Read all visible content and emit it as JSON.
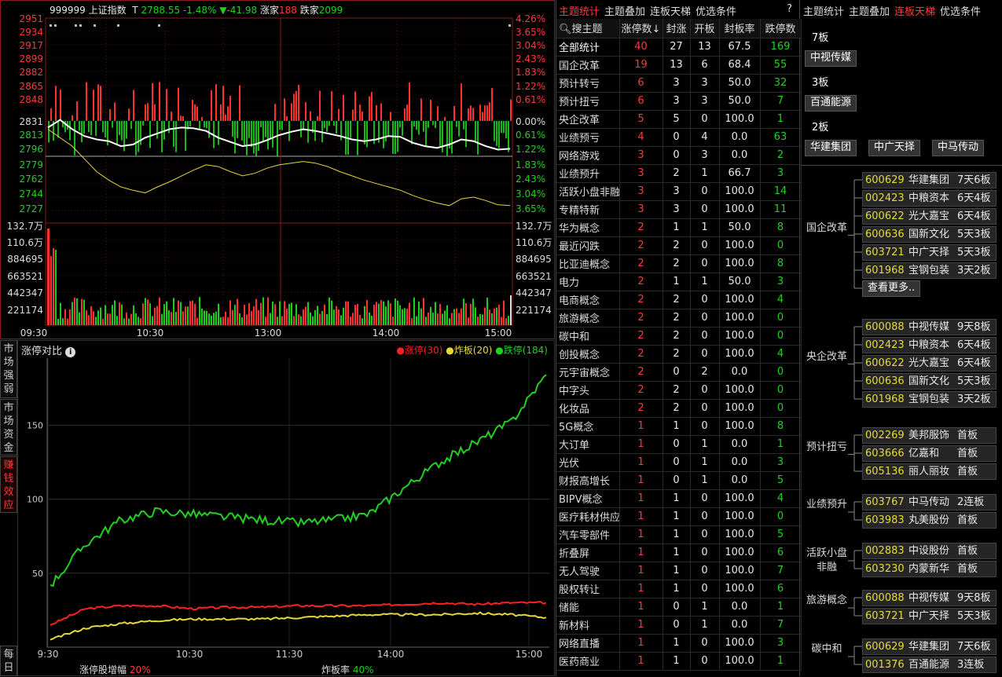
{
  "index_header": {
    "code": "999999",
    "name": "上证指数",
    "t": "T",
    "price": "2788.55",
    "pct": "-1.48%",
    "change": "▼-41.98",
    "up_label": "涨家",
    "up_count": "188",
    "down_label": "跌家",
    "down_count": "2099"
  },
  "price_axis_left": [
    "2951",
    "2934",
    "2917",
    "2899",
    "2882",
    "2865",
    "2848",
    "2831",
    "2813",
    "2796",
    "2779",
    "2762",
    "2744",
    "2727"
  ],
  "price_axis_right": [
    "4.26%",
    "3.65%",
    "3.04%",
    "2.43%",
    "1.83%",
    "1.22%",
    "0.61%",
    "0.00%",
    "0.61%",
    "1.22%",
    "1.83%",
    "2.43%",
    "3.04%",
    "3.65%"
  ],
  "volume_axis_left": [
    "132.7万",
    "110.6万",
    "884695",
    "663521",
    "442347",
    "221174"
  ],
  "volume_axis_right": [
    "132.7万",
    "110.6万",
    "884695",
    "663521",
    "442347",
    "221174"
  ],
  "time_axis": [
    "09:30",
    "10:30",
    "13:00",
    "14:00",
    "15:00"
  ],
  "compare_panel": {
    "title": "涨停对比",
    "info_icon": "info-icon",
    "legend": [
      {
        "label": "涨停(30)",
        "color": "#ff2020"
      },
      {
        "label": "炸板(20)",
        "color": "#e5d93a"
      },
      {
        "label": "跌停(184)",
        "color": "#22d022"
      }
    ],
    "footer_left_label": "涨停股增幅",
    "footer_left_value": "20%",
    "footer_right_label": "炸板率",
    "footer_right_value": "40%"
  },
  "side_tabs": [
    {
      "label": "市场强弱"
    },
    {
      "label": "市场资金"
    },
    {
      "label": "赚钱效应"
    },
    {
      "label": "每日"
    }
  ],
  "chart_data": [
    {
      "type": "line",
      "title": "上证指数",
      "x_range": [
        "09:30",
        "15:00"
      ],
      "ylim": [
        2727,
        2951
      ],
      "series": [
        {
          "name": "上证指数",
          "color": "#ffffff",
          "values": [
            2822,
            2831,
            2820,
            2812,
            2808,
            2806,
            2800,
            2802,
            2810,
            2815,
            2820,
            2822,
            2821,
            2818,
            2810,
            2805,
            2800,
            2802,
            2807,
            2813,
            2817,
            2820,
            2818,
            2815,
            2812,
            2808,
            2806,
            2808,
            2812,
            2811,
            2804,
            2800,
            2798,
            2802,
            2808,
            2806,
            2800,
            2796,
            2797
          ]
        },
        {
          "name": "领先指标",
          "color": "#e5d93a",
          "values": [
            2820,
            2810,
            2800,
            2785,
            2770,
            2760,
            2752,
            2748,
            2745,
            2752,
            2758,
            2765,
            2772,
            2778,
            2776,
            2770,
            2765,
            2768,
            2774,
            2778,
            2780,
            2782,
            2780,
            2776,
            2770,
            2765,
            2760,
            2756,
            2752,
            2748,
            2742,
            2737,
            2733,
            2730,
            2738,
            2740,
            2736,
            2731,
            2730
          ]
        }
      ]
    },
    {
      "type": "line",
      "title": "涨停对比",
      "x": [
        "9:30",
        "10:30",
        "11:30",
        "14:00",
        "15:00"
      ],
      "ylim": [
        0,
        190
      ],
      "yticks": [
        50,
        100,
        150
      ],
      "series": [
        {
          "name": "涨停",
          "color": "#ff2020",
          "values": [
            15,
            26,
            28,
            28,
            26,
            27,
            27,
            28,
            28,
            28,
            29,
            30,
            29,
            30,
            30
          ]
        },
        {
          "name": "炸板",
          "color": "#e5d93a",
          "values": [
            5,
            13,
            16,
            18,
            19,
            19,
            19,
            20,
            21,
            22,
            22,
            22,
            23,
            22,
            20
          ]
        },
        {
          "name": "跌停",
          "color": "#22d022",
          "values": [
            42,
            70,
            86,
            92,
            90,
            88,
            86,
            84,
            86,
            90,
            108,
            125,
            138,
            152,
            184
          ]
        }
      ]
    }
  ],
  "theme_tabs": {
    "tabs": [
      "主题统计",
      "主题叠加",
      "连板天梯",
      "优选条件"
    ],
    "help": "?"
  },
  "theme_table": {
    "search_placeholder": "搜主题",
    "columns": [
      "涨停数↓",
      "封涨",
      "开板",
      "封板率",
      "跌停数"
    ],
    "rows": [
      [
        "全部统计",
        "40",
        "27",
        "13",
        "67.5",
        "169"
      ],
      [
        "国企改革",
        "19",
        "13",
        "6",
        "68.4",
        "55"
      ],
      [
        "预计转亏",
        "6",
        "3",
        "3",
        "50.0",
        "32"
      ],
      [
        "预计扭亏",
        "6",
        "3",
        "3",
        "50.0",
        "7"
      ],
      [
        "央企改革",
        "5",
        "5",
        "0",
        "100.0",
        "1"
      ],
      [
        "业绩预亏",
        "4",
        "0",
        "4",
        "0.0",
        "63"
      ],
      [
        "网络游戏",
        "3",
        "0",
        "3",
        "0.0",
        "2"
      ],
      [
        "业绩预升",
        "3",
        "2",
        "1",
        "66.7",
        "3"
      ],
      [
        "活跃小盘非融",
        "3",
        "3",
        "0",
        "100.0",
        "14"
      ],
      [
        "专精特新",
        "3",
        "3",
        "0",
        "100.0",
        "11"
      ],
      [
        "华为概念",
        "2",
        "1",
        "1",
        "50.0",
        "8"
      ],
      [
        "最近闪跌",
        "2",
        "2",
        "0",
        "100.0",
        "0"
      ],
      [
        "比亚迪概念",
        "2",
        "2",
        "0",
        "100.0",
        "8"
      ],
      [
        "电力",
        "2",
        "1",
        "1",
        "50.0",
        "3"
      ],
      [
        "电商概念",
        "2",
        "2",
        "0",
        "100.0",
        "4"
      ],
      [
        "旅游概念",
        "2",
        "2",
        "0",
        "100.0",
        "0"
      ],
      [
        "碳中和",
        "2",
        "2",
        "0",
        "100.0",
        "0"
      ],
      [
        "创投概念",
        "2",
        "2",
        "0",
        "100.0",
        "4"
      ],
      [
        "元宇宙概念",
        "2",
        "0",
        "2",
        "0.0",
        "0"
      ],
      [
        "中字头",
        "2",
        "2",
        "0",
        "100.0",
        "0"
      ],
      [
        "化妆品",
        "2",
        "2",
        "0",
        "100.0",
        "0"
      ],
      [
        "5G概念",
        "1",
        "1",
        "0",
        "100.0",
        "8"
      ],
      [
        "大订单",
        "1",
        "0",
        "1",
        "0.0",
        "1"
      ],
      [
        "光伏",
        "1",
        "0",
        "1",
        "0.0",
        "3"
      ],
      [
        "财报高增长",
        "1",
        "0",
        "1",
        "0.0",
        "5"
      ],
      [
        "BIPV概念",
        "1",
        "1",
        "0",
        "100.0",
        "4"
      ],
      [
        "医疗耗材供应链",
        "1",
        "1",
        "0",
        "100.0",
        "0"
      ],
      [
        "汽车零部件",
        "1",
        "1",
        "0",
        "100.0",
        "5"
      ],
      [
        "折叠屏",
        "1",
        "1",
        "0",
        "100.0",
        "6"
      ],
      [
        "无人驾驶",
        "1",
        "1",
        "0",
        "100.0",
        "7"
      ],
      [
        "股权转让",
        "1",
        "1",
        "0",
        "100.0",
        "6"
      ],
      [
        "储能",
        "1",
        "0",
        "1",
        "0.0",
        "1"
      ],
      [
        "新材料",
        "1",
        "0",
        "1",
        "0.0",
        "7"
      ],
      [
        "网络直播",
        "1",
        "1",
        "0",
        "100.0",
        "3"
      ],
      [
        "医药商业",
        "1",
        "1",
        "0",
        "100.0",
        "1"
      ]
    ]
  },
  "ladder_tabs": {
    "tabs": [
      "主题统计",
      "主题叠加",
      "连板天梯",
      "优选条件"
    ],
    "active": 2
  },
  "ladder": [
    {
      "label": "7板",
      "stocks": [
        "中视传媒"
      ]
    },
    {
      "label": "3板",
      "stocks": [
        "百通能源"
      ]
    },
    {
      "label": "2板",
      "stocks": [
        "华建集团",
        "中广天择",
        "中马传动"
      ]
    }
  ],
  "theme_groups": [
    {
      "name": "国企改革",
      "stocks": [
        [
          "600629",
          "华建集团",
          "7天6板"
        ],
        [
          "002423",
          "中粮资本",
          "6天4板"
        ],
        [
          "600622",
          "光大嘉宝",
          "6天4板"
        ],
        [
          "600636",
          "国新文化",
          "5天3板"
        ],
        [
          "603721",
          "中广天择",
          "5天3板"
        ],
        [
          "601968",
          "宝钢包装",
          "3天2板"
        ]
      ],
      "more": "查看更多.."
    },
    {
      "name": "央企改革",
      "stocks": [
        [
          "600088",
          "中视传媒",
          "9天8板"
        ],
        [
          "002423",
          "中粮资本",
          "6天4板"
        ],
        [
          "600622",
          "光大嘉宝",
          "6天4板"
        ],
        [
          "600636",
          "国新文化",
          "5天3板"
        ],
        [
          "601968",
          "宝钢包装",
          "3天2板"
        ]
      ]
    },
    {
      "name": "预计扭亏",
      "stocks": [
        [
          "002269",
          "美邦服饰",
          "首板"
        ],
        [
          "603666",
          "亿嘉和",
          "首板"
        ],
        [
          "605136",
          "丽人丽妆",
          "首板"
        ]
      ]
    },
    {
      "name": "业绩预升",
      "stocks": [
        [
          "603767",
          "中马传动",
          "2连板"
        ],
        [
          "603983",
          "丸美股份",
          "首板"
        ]
      ]
    },
    {
      "name": "活跃小盘非融",
      "stocks": [
        [
          "002883",
          "中设股份",
          "首板"
        ],
        [
          "603230",
          "内蒙新华",
          "首板"
        ]
      ]
    },
    {
      "name": "旅游概念",
      "stocks": [
        [
          "600088",
          "中视传媒",
          "9天8板"
        ],
        [
          "603721",
          "中广天择",
          "5天3板"
        ]
      ]
    },
    {
      "name": "碳中和",
      "stocks": [
        [
          "600629",
          "华建集团",
          "7天6板"
        ],
        [
          "001376",
          "百通能源",
          "3连板"
        ]
      ]
    }
  ]
}
